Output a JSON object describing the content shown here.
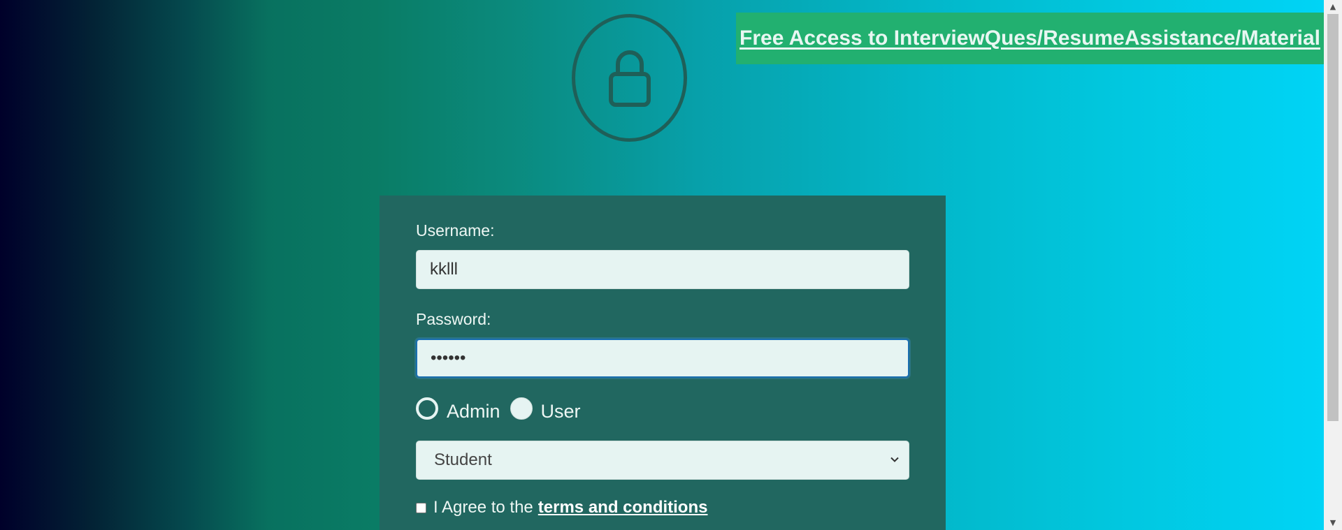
{
  "banner": {
    "link_text": "Free Access to InterviewQues/ResumeAssistance/Material"
  },
  "header": {
    "icon": "lock-icon"
  },
  "form": {
    "username_label": "Username:",
    "username_value": "kklll",
    "password_label": "Password:",
    "password_value": "••••••",
    "roles": [
      {
        "label": "Admin",
        "selected": false
      },
      {
        "label": "User",
        "selected": false
      }
    ],
    "category_selected": "Student",
    "agree_text": "I Agree to the",
    "terms_link": "terms and conditions",
    "agree_checked": false
  },
  "colors": {
    "card_bg": "#216760",
    "banner_bg": "#22b070",
    "input_bg": "#e6f4f2",
    "focus_border": "#1a6fb0"
  }
}
